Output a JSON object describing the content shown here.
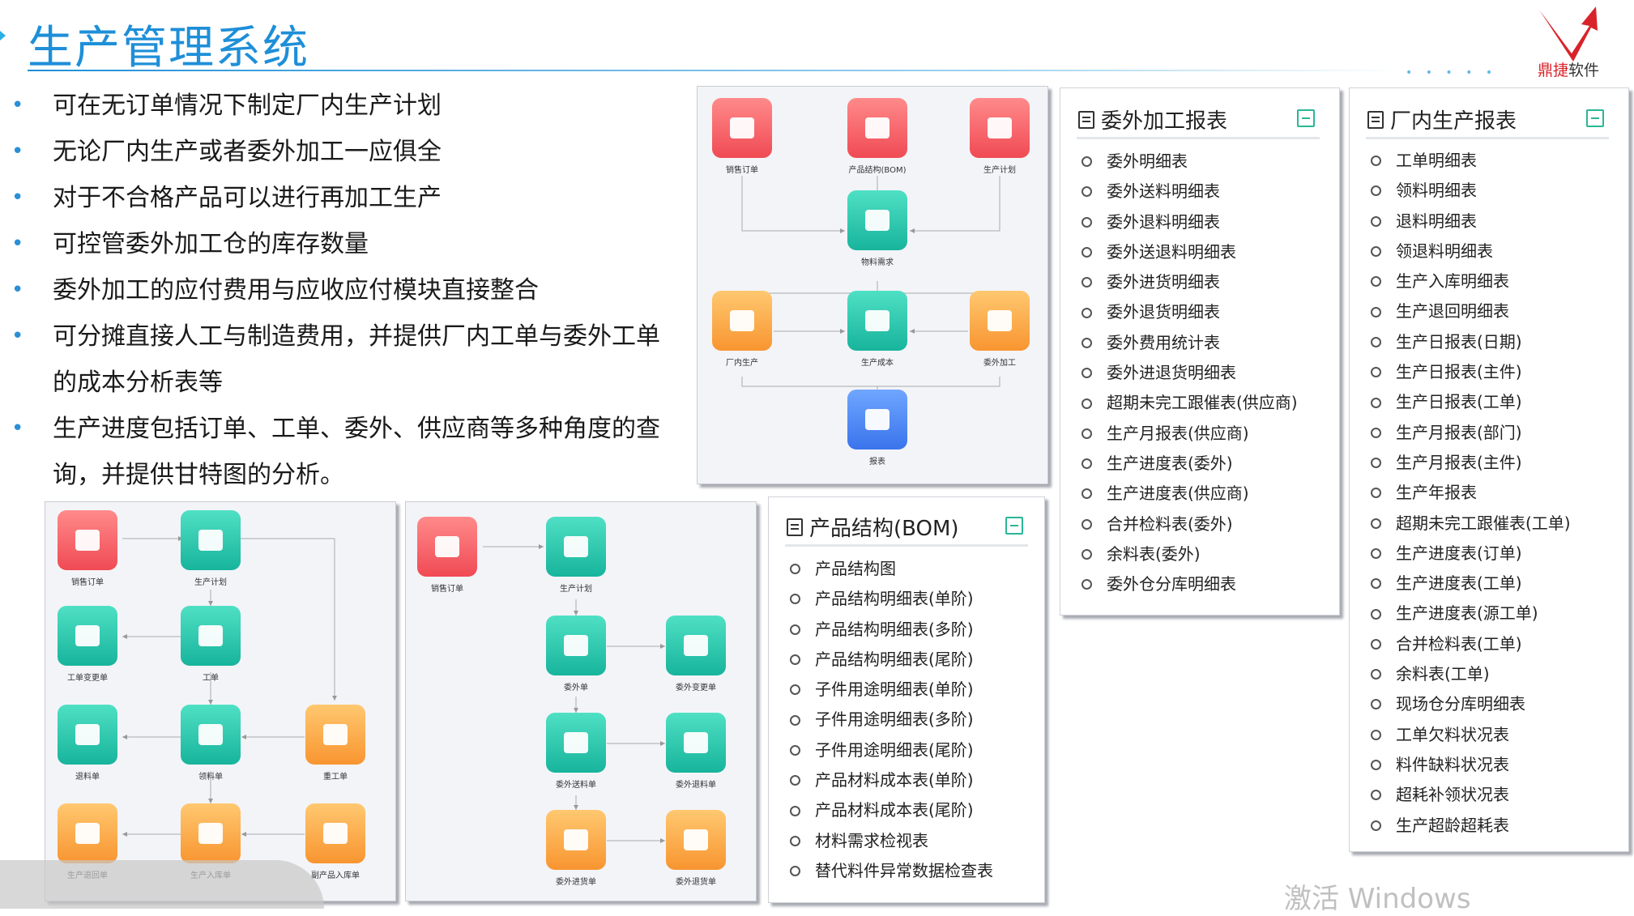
{
  "header": {
    "title": "生产管理系统",
    "logo_text_hl": "鼎捷",
    "logo_text_rest": "软件",
    "brand_color": "#d8232a"
  },
  "bullets": [
    "可在无订单情况下制定厂内生产计划",
    "无论厂内生产或者委外加工一应俱全",
    "对于不合格产品可以进行再加工生产",
    "可控管委外加工仓的库存数量",
    "委外加工的应付费用与应收应付模块直接整合",
    "可分摊直接人工与制造费用，并提供厂内工单与委外工单的成本分析表等",
    "生产进度包括订单、工单、委外、供应商等多种角度的查询，并提供甘特图的分析。"
  ],
  "flow_top": [
    {
      "label": "销售订单",
      "color": "red",
      "icon": "cart-icon"
    },
    {
      "label": "产品结构(BOM)",
      "color": "red",
      "icon": "structure-icon"
    },
    {
      "label": "生产计划",
      "color": "red",
      "icon": "gear-icon"
    },
    {
      "label": "物料需求",
      "color": "teal",
      "icon": "boxes-icon"
    },
    {
      "label": "厂内生产",
      "color": "orange",
      "icon": "factory-icon"
    },
    {
      "label": "生产成本",
      "color": "teal",
      "icon": "chart-icon"
    },
    {
      "label": "委外加工",
      "color": "orange",
      "icon": "handout-icon"
    },
    {
      "label": "报表",
      "color": "blue",
      "icon": "yen-doc-icon"
    }
  ],
  "flow_left": [
    {
      "label": "销售订单",
      "color": "red",
      "icon": "cart-icon"
    },
    {
      "label": "生产计划",
      "color": "teal",
      "icon": "gear-icon"
    },
    {
      "label": "工单变更单",
      "color": "teal",
      "icon": "edit-doc-icon"
    },
    {
      "label": "工单",
      "color": "teal",
      "icon": "printer-icon"
    },
    {
      "label": "退料单",
      "color": "teal",
      "icon": "box-return-icon"
    },
    {
      "label": "领料单",
      "color": "teal",
      "icon": "clipboard-icon"
    },
    {
      "label": "重工单",
      "color": "orange",
      "icon": "rework-icon"
    },
    {
      "label": "生产退回单",
      "color": "orange",
      "icon": "return-doc-icon"
    },
    {
      "label": "生产入库单",
      "color": "orange",
      "icon": "inbound-icon"
    },
    {
      "label": "副产品入库单",
      "color": "orange",
      "icon": "warehouse-icon"
    }
  ],
  "flow_mid": [
    {
      "label": "销售订单",
      "color": "red",
      "icon": "cart-icon"
    },
    {
      "label": "生产计划",
      "color": "teal",
      "icon": "gear-icon"
    },
    {
      "label": "委外单",
      "color": "teal",
      "icon": "outsource-doc-icon"
    },
    {
      "label": "委外变更单",
      "color": "teal",
      "icon": "change-doc-icon"
    },
    {
      "label": "委外送料单",
      "color": "teal",
      "icon": "cart-box-icon"
    },
    {
      "label": "委外退料单",
      "color": "teal",
      "icon": "box-return-icon"
    },
    {
      "label": "委外进货单",
      "color": "orange",
      "icon": "receive-icon"
    },
    {
      "label": "委外退货单",
      "color": "orange",
      "icon": "return-goods-icon"
    }
  ],
  "report_outsource": {
    "title": "委外加工报表",
    "items": [
      "委外明细表",
      "委外送料明细表",
      "委外退料明细表",
      "委外送退料明细表",
      "委外进货明细表",
      "委外退货明细表",
      "委外费用统计表",
      "委外进退货明细表",
      "超期未完工跟催表(供应商)",
      "生产月报表(供应商)",
      "生产进度表(委外)",
      "生产进度表(供应商)",
      "合并检料表(委外)",
      "余料表(委外)",
      "委外仓分库明细表"
    ]
  },
  "report_bom": {
    "title": "产品结构(BOM)",
    "items": [
      "产品结构图",
      "产品结构明细表(单阶)",
      "产品结构明细表(多阶)",
      "产品结构明细表(尾阶)",
      "子件用途明细表(单阶)",
      "子件用途明细表(多阶)",
      "子件用途明细表(尾阶)",
      "产品材料成本表(单阶)",
      "产品材料成本表(尾阶)",
      "材料需求检视表",
      "替代料件异常数据检查表"
    ]
  },
  "report_factory": {
    "title": "厂内生产报表",
    "items": [
      "工单明细表",
      "领料明细表",
      "退料明细表",
      "领退料明细表",
      "生产入库明细表",
      "生产退回明细表",
      "生产日报表(日期)",
      "生产日报表(主件)",
      "生产日报表(工单)",
      "生产月报表(部门)",
      "生产月报表(主件)",
      "生产年报表",
      "超期未完工跟催表(工单)",
      "生产进度表(订单)",
      "生产进度表(工单)",
      "生产进度表(源工单)",
      "合并检料表(工单)",
      "余料表(工单)",
      "现场仓分库明细表",
      "工单欠料状况表",
      "料件缺料状况表",
      "超耗补领状况表",
      "生产超龄超耗表"
    ]
  },
  "watermark": "激活 Windows"
}
